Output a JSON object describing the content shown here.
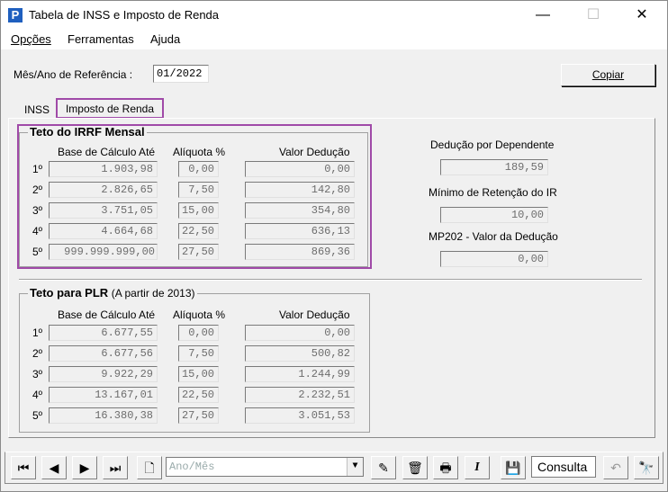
{
  "window": {
    "title": "Tabela de INSS e Imposto de Renda",
    "app_icon": "P",
    "minimize": "—",
    "maximize": "☐",
    "close": "✕"
  },
  "menu": {
    "opcoes": "Opções",
    "ferramentas": "Ferramentas",
    "ajuda": "Ajuda"
  },
  "header": {
    "ref_label": "Mês/Ano de Referência :",
    "ref_value": "01/2022",
    "copy_button": "Copiar"
  },
  "tabs": [
    {
      "label": "INSS"
    },
    {
      "label": "Imposto de Renda"
    }
  ],
  "irrf": {
    "title": "Teto do IRRF Mensal",
    "col_base": "Base de Cálculo Até",
    "col_aliquota": "Alíquota %",
    "col_deducao": "Valor Dedução",
    "rows": [
      {
        "n": "1º",
        "base": "1.903,98",
        "aliq": "0,00",
        "ded": "0,00"
      },
      {
        "n": "2º",
        "base": "2.826,65",
        "aliq": "7,50",
        "ded": "142,80"
      },
      {
        "n": "3º",
        "base": "3.751,05",
        "aliq": "15,00",
        "ded": "354,80"
      },
      {
        "n": "4º",
        "base": "4.664,68",
        "aliq": "22,50",
        "ded": "636,13"
      },
      {
        "n": "5º",
        "base": "999.999.999,00",
        "aliq": "27,50",
        "ded": "869,36"
      }
    ]
  },
  "side": {
    "dependente_label": "Dedução por Dependente",
    "dependente_value": "189,59",
    "minimo_label": "Mínimo de Retenção do IR",
    "minimo_value": "10,00",
    "mp202_label": "MP202 - Valor da Dedução",
    "mp202_value": "0,00"
  },
  "plr": {
    "title": "Teto para PLR",
    "subtitle": "(A partir de 2013)",
    "col_base": "Base de Cálculo Até",
    "col_aliquota": "Alíquota %",
    "col_deducao": "Valor Dedução",
    "rows": [
      {
        "n": "1º",
        "base": "6.677,55",
        "aliq": "0,00",
        "ded": "0,00"
      },
      {
        "n": "2º",
        "base": "6.677,56",
        "aliq": "7,50",
        "ded": "500,82"
      },
      {
        "n": "3º",
        "base": "9.922,29",
        "aliq": "15,00",
        "ded": "1.244,99"
      },
      {
        "n": "4º",
        "base": "13.167,01",
        "aliq": "22,50",
        "ded": "2.232,51"
      },
      {
        "n": "5º",
        "base": "16.380,38",
        "aliq": "27,50",
        "ded": "3.051,53"
      }
    ]
  },
  "toolbar": {
    "combo_placeholder": "Ano/Mês",
    "combo_arrow": "▼",
    "consulta": "Consulta",
    "icons": {
      "first": "⏮",
      "prev": "◀",
      "next": "▶",
      "last": "⏭",
      "new": "🗋",
      "edit": "✎",
      "delete": "🗑",
      "print": "🖶",
      "italic": "I",
      "save": "💾",
      "undo": "↶",
      "search": "🔭"
    }
  }
}
